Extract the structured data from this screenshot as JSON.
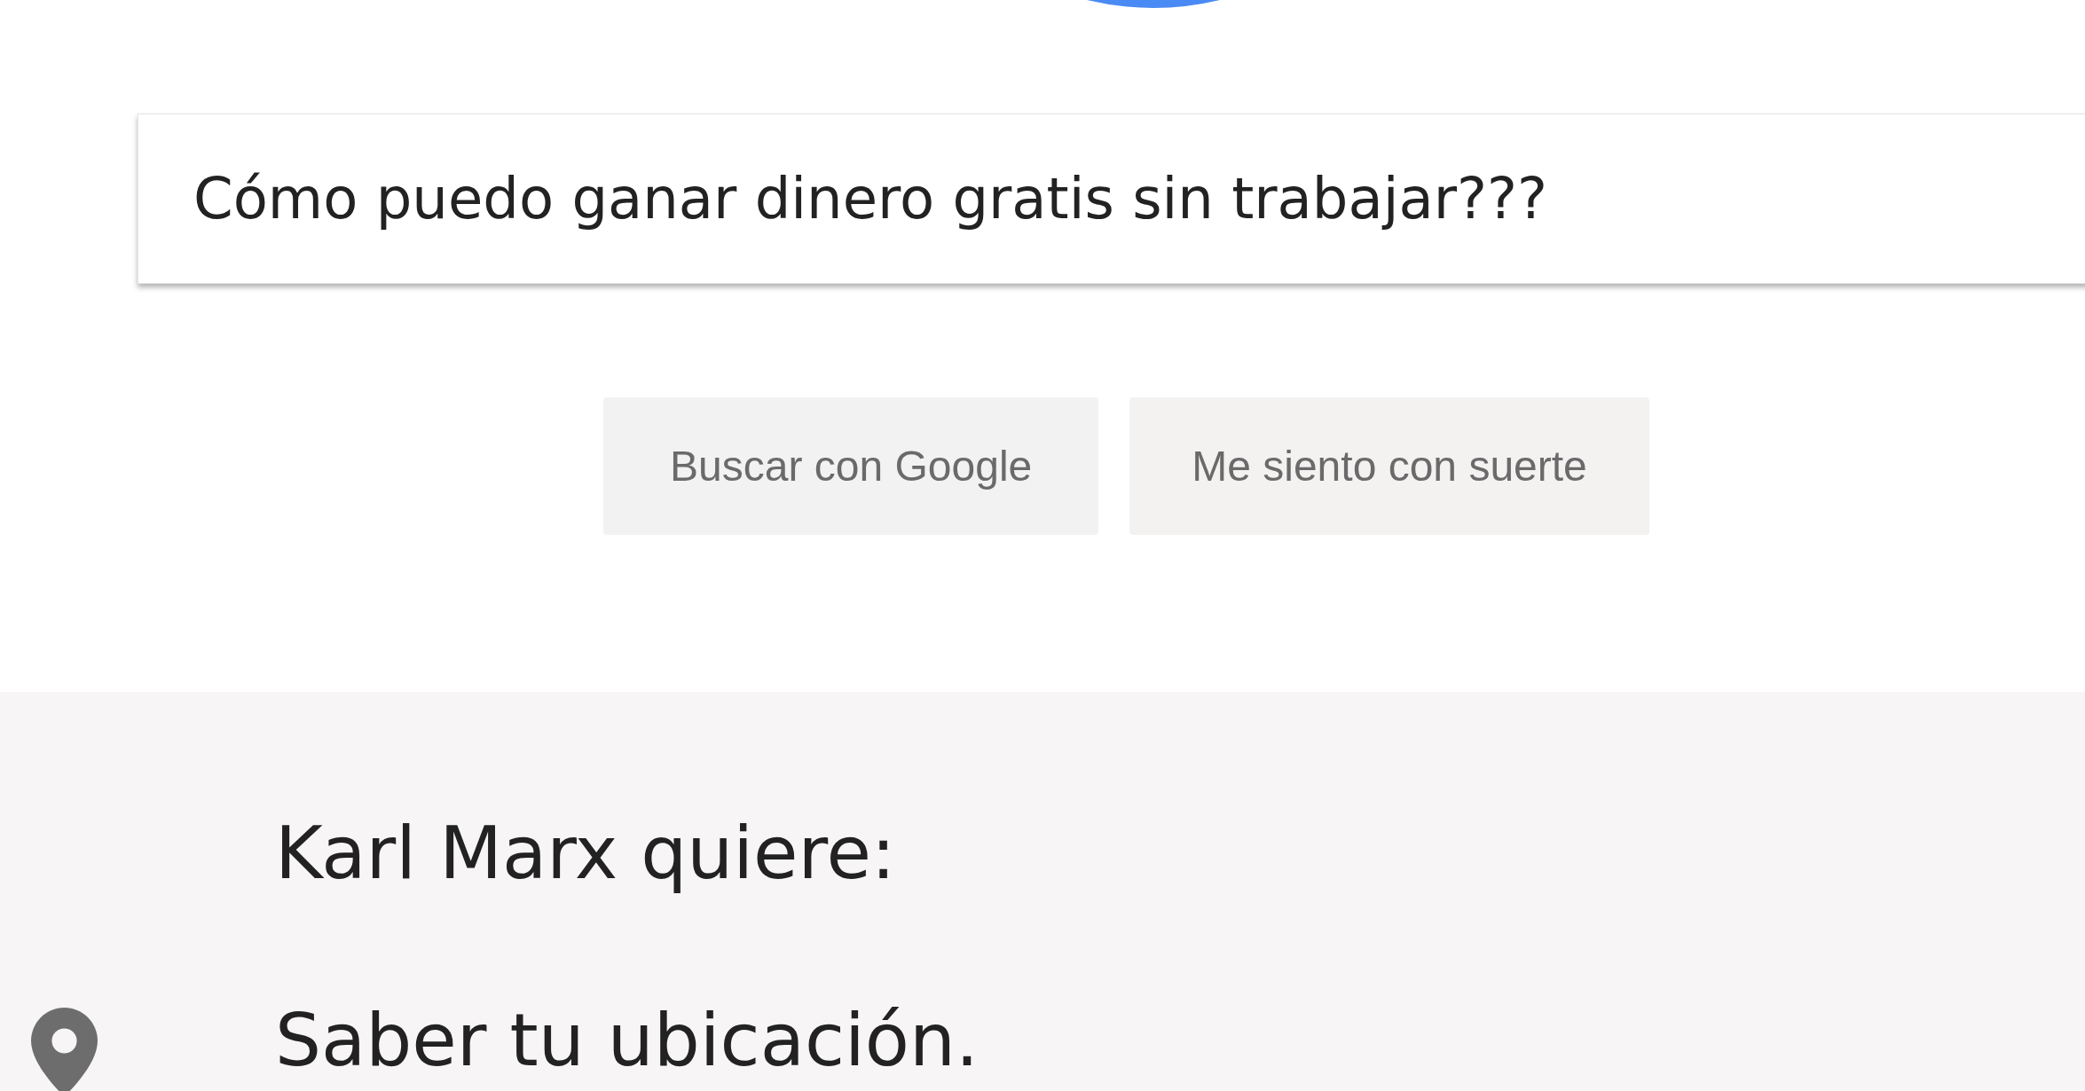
{
  "search": {
    "value": "Cómo puedo ganar dinero gratis sin trabajar???"
  },
  "buttons": [
    "Buscar con Google",
    "Me siento con suerte"
  ],
  "permission": {
    "heading": "Karl Marx quiere:",
    "items": [
      {
        "kind": "location",
        "text": "Saber tu ubicación."
      }
    ]
  }
}
